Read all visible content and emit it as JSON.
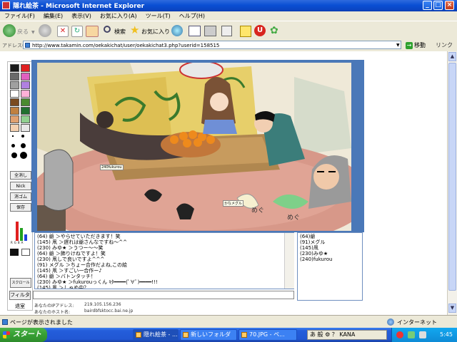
{
  "window": {
    "title": "隠れ絵茶 - Microsoft Internet Explorer",
    "min": "_",
    "max": "□",
    "close": "×"
  },
  "menu": [
    "ファイル(F)",
    "編集(E)",
    "表示(V)",
    "お気に入り(A)",
    "ツール(T)",
    "ヘルプ(H)"
  ],
  "toolbar": {
    "back": "戻る",
    "search": "検索",
    "favorites": "お気に入り"
  },
  "address": {
    "label": "アドレス(D)",
    "url": "http://www.takamin.com/oekakichat/user/oekakichat3.php?userid=158515",
    "go": "移動",
    "links": "リンク"
  },
  "palette": {
    "colors": [
      "#1a1a1a",
      "#e02020",
      "#6a6a6a",
      "#e060c0",
      "#a0a0a0",
      "#b080e0",
      "#ffffff",
      "#ffb0d8",
      "#7a4a20",
      "#4a8a30",
      "#c08040",
      "#207030",
      "#e0a070",
      "#90d090",
      "#f4d0b0",
      "#e8e8e8"
    ],
    "buttons": {
      "clear": "全消し",
      "nick": "Nick",
      "eraser": "消ゴム",
      "save": "保存"
    },
    "rgb_labels": [
      "R",
      "G",
      "B",
      "A"
    ],
    "bar_levels": [
      0.9,
      0.6,
      0.3
    ],
    "replay": "スクロール"
  },
  "canvas": {
    "labels": [
      "240fukurou",
      "かなメグル"
    ]
  },
  "chat": {
    "lines": [
      "(64) 爺 ＞やらせていただきます！笑",
      "(145) 凧 ＞遅れは爺さんなですね～^^",
      "(230) みゆ★ ＞うつー～～笑",
      "(64) 爺 ＞飾りけねですよ！笑",
      "(230) 凧しで良いですよ^^^",
      "(91) メグル ＞ちょー合作だよね,この絵",
      "(145) 凧 ＞すごい一合作ー♪",
      "(64) 爺 ＞バトンタッチ！",
      "(230) みゆ★ ＞fukurouっくん ｷﾀ━━━━(ﾟ∀ﾟ)━━━━!!!",
      "(145) 凧 ＞しゃめ中？"
    ]
  },
  "users": [
    "(64)爺",
    "(91)メグル",
    "(145)凧",
    "(230)みゆ★",
    "(240)fukurou"
  ],
  "form": {
    "filter": "フィルタ",
    "leave": "退室",
    "ip_label": "あなたのIPアドレス:",
    "ip_value": "219.105.156.236",
    "host_label": "あなたのホスト名:",
    "host_value": "bairdbfsktocc.bai.ne.jp"
  },
  "status": {
    "text": "ページが表示されました",
    "zone": "インターネット"
  },
  "taskbar": {
    "start": "スタート",
    "tasks": [
      "隠れ絵茶 - ...",
      "新しいフォルダ",
      "70.JPG - ペ..."
    ],
    "ime": "あ 般 ⚙ ？ KANA",
    "clock": "5:45"
  }
}
